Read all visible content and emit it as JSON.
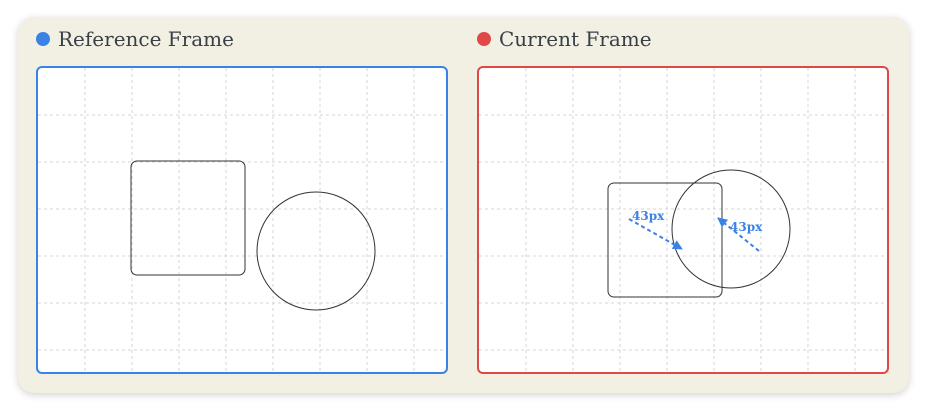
{
  "reference": {
    "title": "Reference Frame",
    "color": "#3b82e6"
  },
  "current": {
    "title": "Current Frame",
    "color": "#e04848"
  },
  "motion": {
    "color": "#3b82e6",
    "square_label": "43px",
    "circle_label": "43px"
  }
}
